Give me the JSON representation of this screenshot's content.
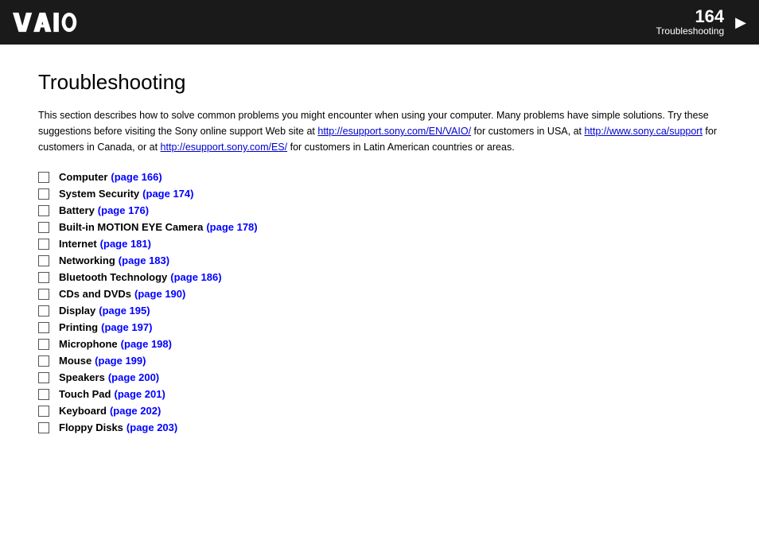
{
  "header": {
    "page_number": "164",
    "section_label": "Troubleshooting",
    "arrow": "▶"
  },
  "page_title": "Troubleshooting",
  "intro": {
    "text_before_link1": "This section describes how to solve common problems you might encounter when using your computer. Many problems have simple solutions. Try these suggestions before visiting the Sony online support Web site at ",
    "link1_text": "http://esupport.sony.com/EN/VAIO/",
    "link1_href": "http://esupport.sony.com/EN/VAIO/",
    "text_between_1_2": " for customers in USA, at ",
    "link2_text": "http://www.sony.ca/support",
    "link2_href": "http://www.sony.ca/support",
    "text_between_2_3": " for customers in Canada, or at ",
    "link3_text": "http://esupport.sony.com/ES/",
    "link3_href": "http://esupport.sony.com/ES/",
    "text_after_link3": " for customers in Latin American countries or areas."
  },
  "toc_items": [
    {
      "label": "Computer",
      "link_text": "(page 166)",
      "link_href": "#166"
    },
    {
      "label": "System Security",
      "link_text": "(page 174)",
      "link_href": "#174"
    },
    {
      "label": "Battery",
      "link_text": "(page 176)",
      "link_href": "#176"
    },
    {
      "label": "Built-in MOTION EYE Camera",
      "link_text": "(page 178)",
      "link_href": "#178"
    },
    {
      "label": "Internet",
      "link_text": "(page 181)",
      "link_href": "#181"
    },
    {
      "label": "Networking",
      "link_text": "(page 183)",
      "link_href": "#183"
    },
    {
      "label": "Bluetooth Technology",
      "link_text": "(page 186)",
      "link_href": "#186"
    },
    {
      "label": "CDs and DVDs",
      "link_text": "(page 190)",
      "link_href": "#190"
    },
    {
      "label": "Display",
      "link_text": "(page 195)",
      "link_href": "#195"
    },
    {
      "label": "Printing",
      "link_text": "(page 197)",
      "link_href": "#197"
    },
    {
      "label": "Microphone",
      "link_text": "(page 198)",
      "link_href": "#198"
    },
    {
      "label": "Mouse",
      "link_text": "(page 199)",
      "link_href": "#199"
    },
    {
      "label": "Speakers",
      "link_text": "(page 200)",
      "link_href": "#200"
    },
    {
      "label": "Touch Pad",
      "link_text": "(page 201)",
      "link_href": "#201"
    },
    {
      "label": "Keyboard",
      "link_text": "(page 202)",
      "link_href": "#202"
    },
    {
      "label": "Floppy Disks",
      "link_text": "(page 203)",
      "link_href": "#203"
    }
  ]
}
